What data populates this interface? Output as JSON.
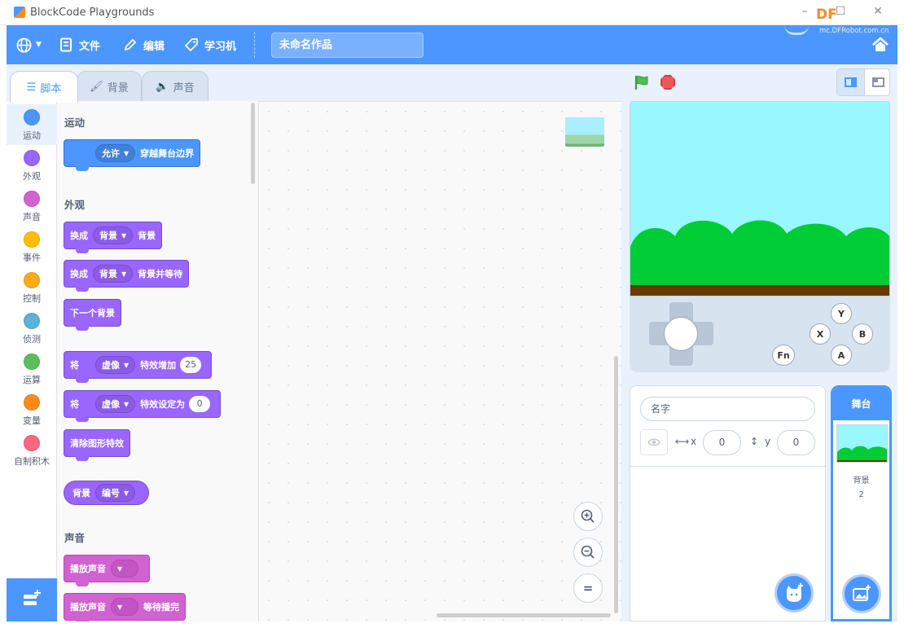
{
  "window": {
    "title": "BlockCode Playgrounds",
    "logo_text": "DF",
    "minimize": "–",
    "maximize": "☐",
    "close": "✕"
  },
  "menubar": {
    "language_icon": "globe-icon",
    "file_label": "文件",
    "edit_label": "编辑",
    "learn_label": "学习机",
    "project_title": "未命名作品",
    "brand_url": "mc.DFRobot.com.cn",
    "home_icon": "home-icon",
    "color": "#4c97ff"
  },
  "tabs": [
    {
      "label": "脚本",
      "icon": "code-icon",
      "active": true
    },
    {
      "label": "背景",
      "icon": "brush-icon",
      "active": false
    },
    {
      "label": "声音",
      "icon": "speaker-icon",
      "active": false
    }
  ],
  "categories": [
    {
      "label": "运动",
      "color": "#4c97ff"
    },
    {
      "label": "外观",
      "color": "#9966ff"
    },
    {
      "label": "声音",
      "color": "#cf63cf"
    },
    {
      "label": "事件",
      "color": "#ffbf00"
    },
    {
      "label": "控制",
      "color": "#ffab19"
    },
    {
      "label": "侦测",
      "color": "#5cb1d6"
    },
    {
      "label": "运算",
      "color": "#59c059"
    },
    {
      "label": "变量",
      "color": "#ff8c1a"
    },
    {
      "label": "自制积木",
      "color": "#ff6680"
    }
  ],
  "palette": {
    "motion_title": "运动",
    "looks_title": "外观",
    "sound_title": "声音",
    "blocks": {
      "motion_allow": {
        "dropdown": "允许",
        "text": "穿越舞台边界"
      },
      "switch_backdrop": {
        "prefix": "换成",
        "dropdown": "背景",
        "suffix": "背景"
      },
      "switch_backdrop_wait": {
        "prefix": "换成",
        "dropdown": "背景",
        "suffix": "背景并等待"
      },
      "next_backdrop": {
        "text": "下一个背景"
      },
      "change_effect": {
        "prefix": "将",
        "dropdown": "虚像",
        "middle": "特效增加",
        "value": "25"
      },
      "set_effect": {
        "prefix": "将",
        "dropdown": "虚像",
        "middle": "特效设定为",
        "value": "0"
      },
      "clear_effects": {
        "text": "清除图形特效"
      },
      "backdrop_reporter": {
        "prefix": "背景",
        "dropdown": "编号"
      },
      "play_sound": {
        "text": "播放声音"
      },
      "play_sound_wait": {
        "prefix": "播放声音",
        "suffix": "等待播完"
      }
    }
  },
  "workspace": {
    "zoom_in_icon": "zoom-in-icon",
    "zoom_out_icon": "zoom-out-icon",
    "zoom_reset_icon": "zoom-reset-icon",
    "zoom_in": "+",
    "zoom_out": "−",
    "zoom_reset": "="
  },
  "stage_controls": {
    "green_flag_icon": "green-flag-icon",
    "stop_icon": "stop-icon"
  },
  "gamepad": {
    "buttons": [
      "Y",
      "X",
      "B",
      "A",
      "Fn"
    ]
  },
  "sprite_info": {
    "name_placeholder": "名字",
    "x_label": "x",
    "y_label": "y",
    "x_value": "0",
    "y_value": "0"
  },
  "stage_panel": {
    "title": "舞台",
    "backdrop_label": "背景",
    "backdrop_count": "2"
  }
}
